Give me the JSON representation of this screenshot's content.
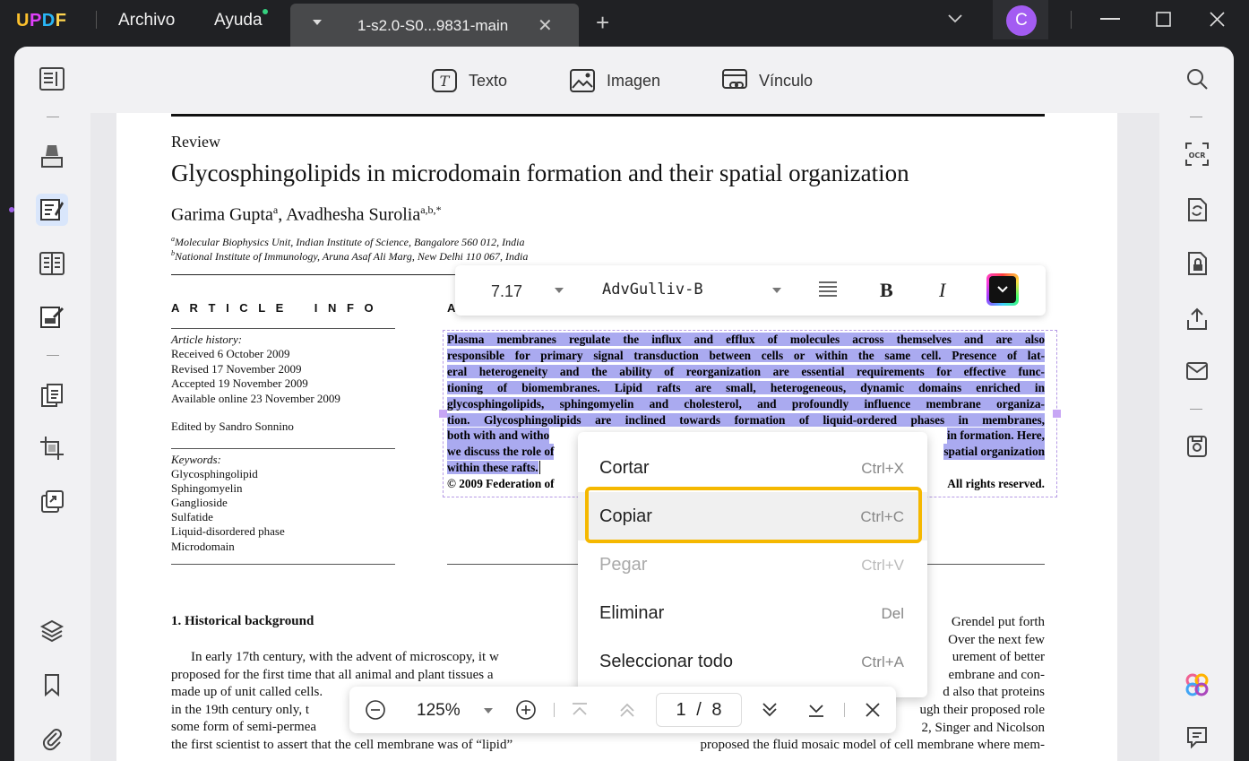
{
  "app": {
    "menu": [
      "Archivo",
      "Ayuda"
    ],
    "tab_title": "1-s2.0-S0...9831-main",
    "avatar_letter": "C",
    "accent_color": "#a35cf2"
  },
  "toolbar": {
    "text_label": "Texto",
    "image_label": "Imagen",
    "link_label": "Vínculo"
  },
  "document": {
    "category": "Review",
    "title": "Glycosphingolipids in microdomain formation and their spatial organization",
    "author1": "Garima Gupta",
    "author1_sup": "a",
    "author2": ", Avadhesha Surolia",
    "author2_sup": "a,b,",
    "author2_star": "*",
    "affil_a_sup": "a",
    "affil_a": "Molecular Biophysics Unit, Indian Institute of Science, Bangalore 560 012, India",
    "affil_b_sup": "b",
    "affil_b": "National Institute of Immunology, Aruna Asaf Ali Marg, New Delhi 110 067, India",
    "article_info_heading": "A R T I C L E    I N F O",
    "abstract_heading_partial": "A",
    "article_history_label": "Article history:",
    "history": [
      "Received 6 October 2009",
      "Revised 17 November 2009",
      "Accepted 19 November 2009",
      "Available online 23 November 2009"
    ],
    "edited_by": "Edited by Sandro Sonnino",
    "keywords_label": "Keywords:",
    "keywords": [
      "Glycosphingolipid",
      "Sphingomyelin",
      "Ganglioside",
      "Sulfatide",
      "Liquid-disordered phase",
      "Microdomain"
    ],
    "abstract_lines": [
      "Plasma membranes regulate the influx and efflux of molecules across themselves and are also",
      "responsible for primary signal transduction between cells or within the same cell. Presence of lat-",
      "eral heterogeneity and the ability of reorganization are essential requirements for effective func-",
      "tioning of biomembranes. Lipid rafts are small, heterogeneous, dynamic domains enriched in",
      "glycosphingolipids, sphingomyelin and cholesterol, and profoundly influence membrane organiza-",
      "tion. Glycosphingolipids are inclined towards formation of liquid-ordered phases in membranes,"
    ],
    "abstract_line7_left": "both with and witho",
    "abstract_line7_right": "in formation. Here,",
    "abstract_line8_left": "we discuss the role of",
    "abstract_line8_right": "spatial organization",
    "abstract_line9": "within these rafts.",
    "copyright_left": "© 2009 Federation of",
    "copyright_right": "All rights reserved.",
    "section_heading": "1. Historical background",
    "body_left": [
      "In early 17th century, with the advent of microscopy, it w",
      "proposed for the first time that all animal and plant tissues a",
      "made up of unit called cells.",
      "in the 19th century only, t",
      "some form of semi-permea",
      "the first scientist to assert that the cell membrane was of “lipid”"
    ],
    "body_right": [
      "Grendel put forth",
      "Over the next few",
      "urement of better",
      "embrane and con-",
      "d also that proteins",
      "ugh their proposed role",
      "2, Singer and Nicolson",
      "proposed the fluid mosaic model of cell membrane where mem-"
    ]
  },
  "font_toolbar": {
    "size": "7.17",
    "font_name": "AdvGulliv-B",
    "bold_label": "B",
    "italic_label": "I"
  },
  "context_menu": {
    "items": [
      {
        "label": "Cortar",
        "shortcut": "Ctrl+X"
      },
      {
        "label": "Copiar",
        "shortcut": "Ctrl+C"
      },
      {
        "label": "Pegar",
        "shortcut": "Ctrl+V"
      },
      {
        "label": "Eliminar",
        "shortcut": "Del"
      },
      {
        "label": "Seleccionar todo",
        "shortcut": "Ctrl+A"
      }
    ]
  },
  "bottom_nav": {
    "zoom": "125%",
    "current_page": "1",
    "page_separator": "/",
    "total_pages": "8"
  }
}
